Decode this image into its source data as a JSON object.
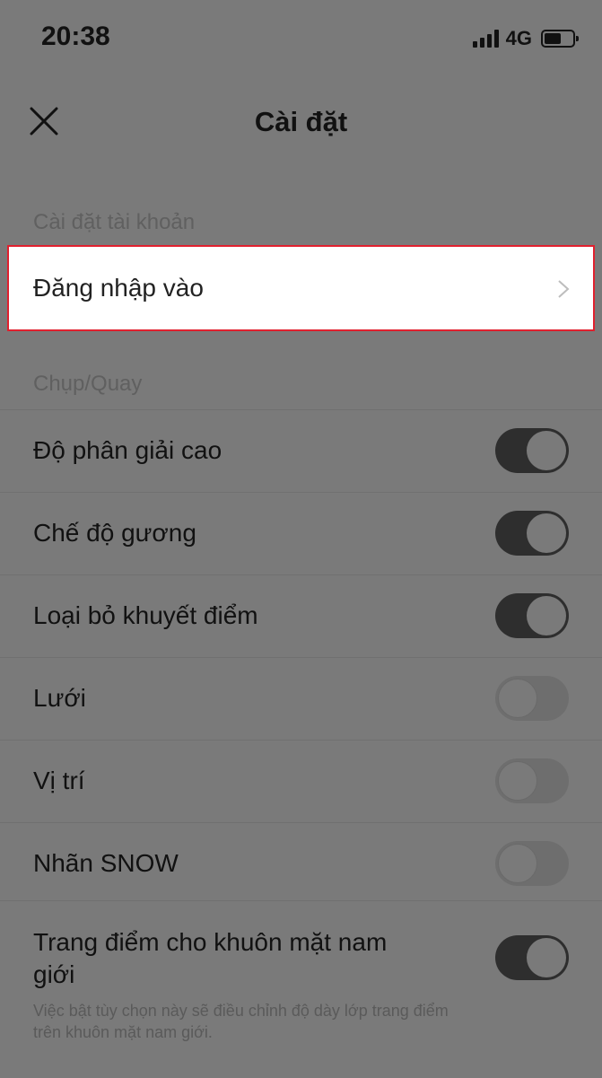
{
  "status_bar": {
    "time": "20:38",
    "network": "4G"
  },
  "nav": {
    "title": "Cài đặt"
  },
  "account_section": {
    "header": "Cài đặt tài khoản",
    "login_label": "Đăng nhập vào"
  },
  "capture_section": {
    "header": "Chụp/Quay",
    "items": [
      {
        "label": "Độ phân giải cao",
        "on": true
      },
      {
        "label": "Chế độ gương",
        "on": true
      },
      {
        "label": "Loại bỏ khuyết điểm",
        "on": true
      },
      {
        "label": "Lưới",
        "on": false
      },
      {
        "label": "Vị trí",
        "on": false
      },
      {
        "label": "Nhãn SNOW",
        "on": false
      }
    ],
    "male_makeup": {
      "label": "Trang điểm cho khuôn mặt nam giới",
      "description": "Việc bật tùy chọn này sẽ điều chỉnh độ dày lớp trang điểm trên khuôn mặt nam giới.",
      "on": true
    }
  },
  "colors": {
    "highlight_border": "#e0202e",
    "toggle_on": "#2e2e2e"
  }
}
